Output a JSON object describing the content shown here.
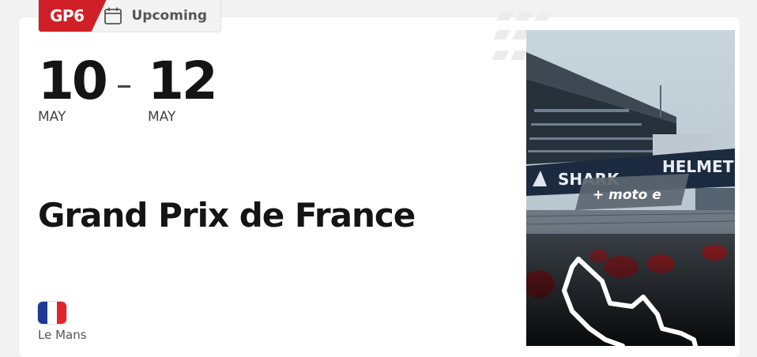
{
  "event": {
    "round": "GP6",
    "status": "Upcoming",
    "start_day": "10",
    "start_month": "MAY",
    "end_day": "12",
    "end_month": "MAY",
    "name": "Grand Prix de France",
    "location": "Le Mans",
    "country_flag_icon": "france-flag-icon",
    "extra_class_logo": "+ moto e",
    "banner_text_left": "SHARK",
    "banner_text_right": "HELMET"
  },
  "colors": {
    "round_badge_bg": "#d01f26",
    "flag_blue": "#1f3a93",
    "flag_white": "#ffffff",
    "flag_red": "#e0262b",
    "motoe_green": "#7ac70c"
  }
}
